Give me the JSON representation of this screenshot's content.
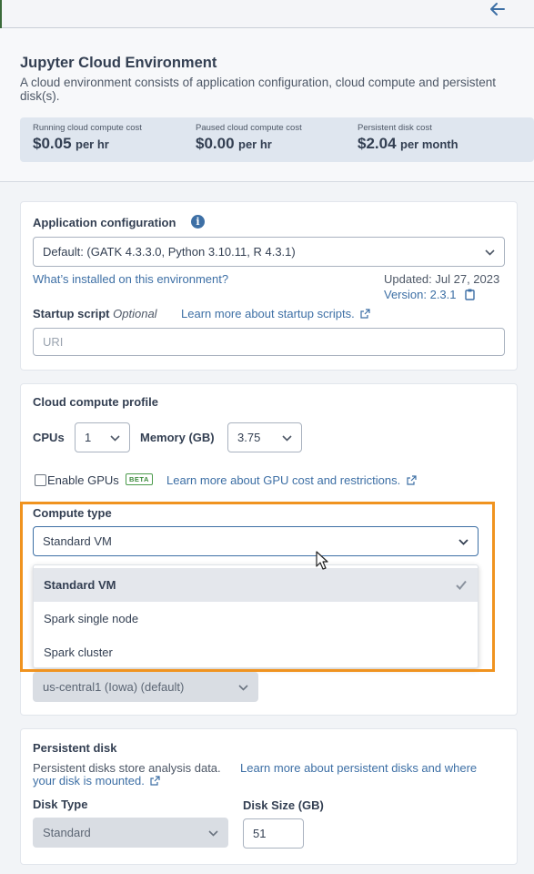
{
  "header": {
    "title": "Jupyter Cloud Environment",
    "subtitle": "A cloud environment consists of application configuration, cloud compute and persistent disk(s).",
    "costs": [
      {
        "label": "Running cloud compute cost",
        "value": "$0.05",
        "unit": "per hr"
      },
      {
        "label": "Paused cloud compute cost",
        "value": "$0.00",
        "unit": "per hr"
      },
      {
        "label": "Persistent disk cost",
        "value": "$2.04",
        "unit": "per month"
      }
    ]
  },
  "app_config": {
    "label": "Application configuration",
    "selected": "Default: (GATK 4.3.3.0, Python 3.10.11, R 4.3.1)",
    "whats_installed_link": "What’s installed on this environment?",
    "updated": "Updated: Jul 27, 2023",
    "version": "Version: 2.3.1",
    "startup_label": "Startup script",
    "startup_optional": "Optional",
    "startup_link": "Learn more about startup scripts.",
    "startup_placeholder": "URI"
  },
  "compute": {
    "label": "Cloud compute profile",
    "cpus_label": "CPUs",
    "cpus_value": "1",
    "memory_label": "Memory (GB)",
    "memory_value": "3.75",
    "enable_gpus_label": "Enable GPUs",
    "enable_gpus_checked": false,
    "beta_badge": "BETA",
    "gpu_link": "Learn more about GPU cost and restrictions.",
    "compute_type_label": "Compute type",
    "compute_type_value": "Standard VM",
    "compute_type_options": [
      "Standard VM",
      "Spark single node",
      "Spark cluster"
    ],
    "location_value": "us-central1 (Iowa) (default)"
  },
  "disk": {
    "label": "Persistent disk",
    "description": "Persistent disks store analysis data.",
    "link_line1": "Learn more about persistent disks and where",
    "link_line2": "your disk is mounted.",
    "disk_type_label": "Disk Type",
    "disk_type_value": "Standard",
    "disk_size_label": "Disk Size (GB)",
    "disk_size_value": "51"
  },
  "colors": {
    "accent_link": "#3d6fa5",
    "highlight_border": "#f0931f",
    "beta_green": "#3c8a3c"
  }
}
